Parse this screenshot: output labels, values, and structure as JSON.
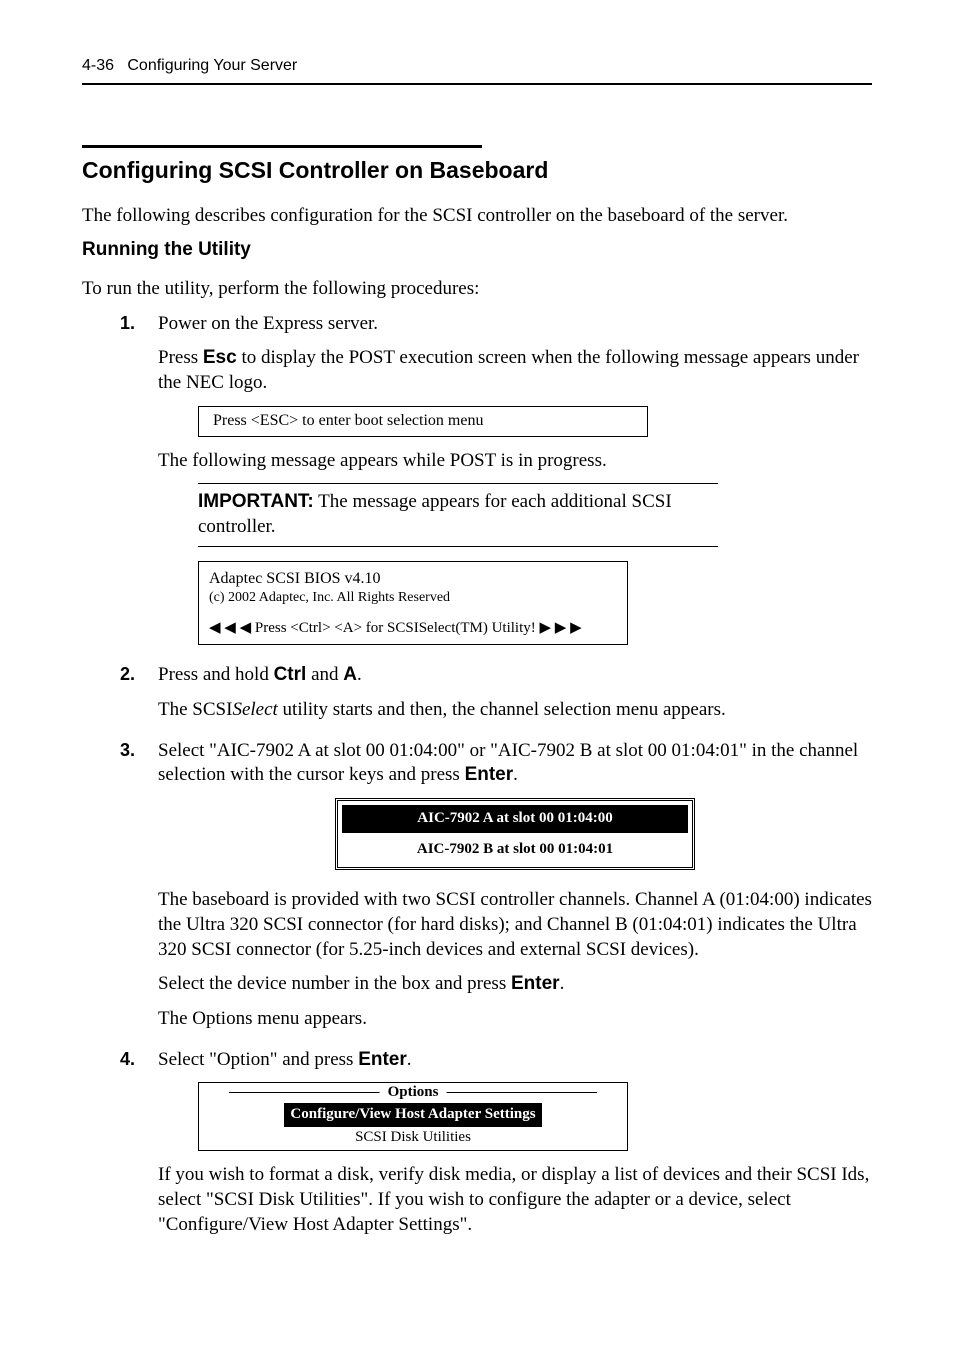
{
  "header": {
    "page_ref": "4-36",
    "chapter": "Configuring Your Server"
  },
  "section": {
    "title": "Configuring SCSI Controller on Baseboard",
    "intro": "The following describes configuration for the SCSI controller on the baseboard of the server."
  },
  "sub": {
    "title": "Running the Utility",
    "intro": "To run the utility, perform the following procedures:"
  },
  "steps": {
    "s1": {
      "num": "1.",
      "line1": "Power on the Express server.",
      "line2a": "Press ",
      "esc": "Esc",
      "line2b": " to display the POST execution screen when the following message appears under the NEC logo.",
      "box1": "Press <ESC> to enter boot selection menu",
      "line3": "The following message appears while POST is in progress.",
      "important_label": "IMPORTANT:",
      "important_text": " The message appears for each additional SCSI controller.",
      "bios_l1": "Adaptec SCSI BIOS v4.10",
      "bios_l2": "(c) 2002 Adaptec, Inc. All Rights Reserved",
      "bios_l3": "◀ ◀ ◀ Press <Ctrl> <A> for SCSISelect(TM) Utility! ▶ ▶ ▶"
    },
    "s2": {
      "num": "2.",
      "line1a": "Press and hold ",
      "ctrl": "Ctrl",
      "and": " and ",
      "a": "A",
      "period": ".",
      "line2a": "The SCSI",
      "italic": "Select",
      "line2b": " utility starts and then, the channel selection menu appears."
    },
    "s3": {
      "num": "3.",
      "line1a": "Select \"AIC-7902 A at slot 00 01:04:00\" or \"AIC-7902 B at slot 00 01:04:01\" in the channel selection with the cursor keys and press ",
      "enter": "Enter",
      "period": ".",
      "sel_a": "AIC-7902 A at slot 00 01:04:00",
      "sel_b": "AIC-7902 B at slot 00 01:04:01",
      "para2": "The baseboard is provided with two SCSI controller channels. Channel A (01:04:00) indicates the Ultra 320 SCSI connector (for hard disks); and Channel B (01:04:01) indicates the Ultra 320 SCSI connector (for 5.25-inch devices and external SCSI devices).",
      "para3a": "Select the device number in the box and press ",
      "para3b": ".",
      "para4": "The Options menu appears."
    },
    "s4": {
      "num": "4.",
      "line1a": "Select \"Option\" and press ",
      "enter": "Enter",
      "period": ".",
      "opt_title": "Options",
      "opt_sel": "Configure/View Host Adapter Settings",
      "opt_unsel": "SCSI Disk Utilities",
      "para2": "If you wish to format a disk, verify disk media, or display a list of devices and their SCSI Ids, select \"SCSI Disk Utilities\". If you wish to configure the adapter or a device, select \"Configure/View Host Adapter Settings\"."
    }
  }
}
